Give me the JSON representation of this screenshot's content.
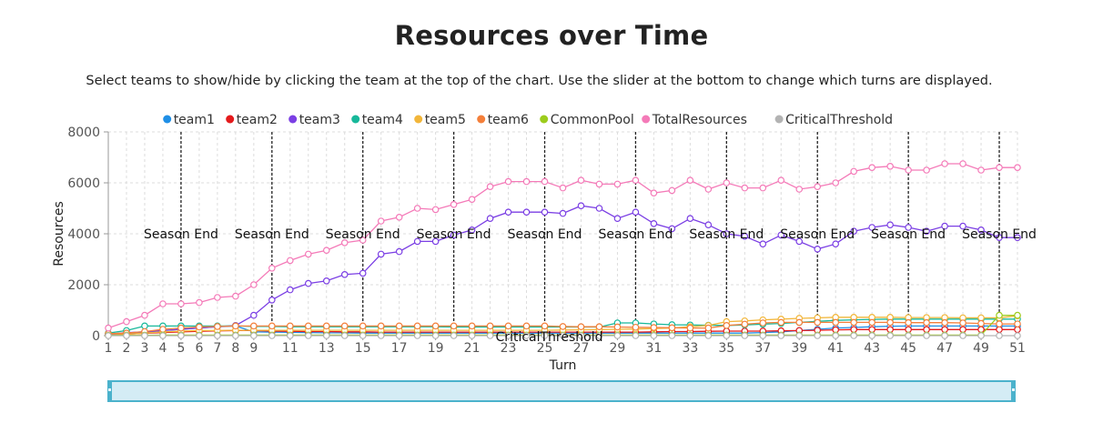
{
  "header": {
    "title": "Resources over Time",
    "subtitle": "Select teams to show/hide by clicking the team at the top of the chart. Use the slider at the bottom to change which turns are displayed."
  },
  "chart_data": {
    "type": "line",
    "xlabel": "Turn",
    "ylabel": "Resources",
    "xlim": [
      1,
      51
    ],
    "ylim": [
      0,
      8000
    ],
    "y_ticks": [
      0,
      2000,
      4000,
      6000,
      8000
    ],
    "x_ticks": [
      1,
      2,
      3,
      4,
      5,
      6,
      7,
      8,
      9,
      11,
      13,
      15,
      17,
      19,
      21,
      23,
      25,
      27,
      29,
      31,
      33,
      35,
      37,
      39,
      41,
      43,
      45,
      47,
      49,
      51
    ],
    "grid": true,
    "legend_position": "top",
    "x": [
      1,
      2,
      3,
      4,
      5,
      6,
      7,
      8,
      9,
      10,
      11,
      12,
      13,
      14,
      15,
      16,
      17,
      18,
      19,
      20,
      21,
      22,
      23,
      24,
      25,
      26,
      27,
      28,
      29,
      30,
      31,
      32,
      33,
      34,
      35,
      36,
      37,
      38,
      39,
      40,
      41,
      42,
      43,
      45,
      44,
      46,
      47,
      48,
      49,
      50,
      51
    ],
    "season_end_turns": [
      5,
      10,
      15,
      20,
      25,
      30,
      35,
      40,
      45,
      50
    ],
    "season_end_label": "Season End",
    "threshold_label": "CriticalThreshold",
    "series": [
      {
        "name": "team1",
        "color": "#1f8fe6",
        "values": [
          50,
          80,
          120,
          200,
          250,
          300,
          350,
          380,
          150,
          140,
          130,
          120,
          110,
          110,
          100,
          100,
          100,
          100,
          100,
          100,
          100,
          100,
          100,
          100,
          100,
          100,
          100,
          100,
          100,
          100,
          100,
          100,
          100,
          100,
          100,
          100,
          120,
          150,
          200,
          250,
          300,
          320,
          350,
          370,
          380,
          380,
          380,
          380,
          380,
          380,
          380
        ]
      },
      {
        "name": "team2",
        "color": "#e41a1c",
        "values": [
          30,
          60,
          90,
          120,
          150,
          170,
          190,
          200,
          200,
          180,
          170,
          160,
          160,
          150,
          150,
          140,
          140,
          140,
          140,
          140,
          140,
          140,
          140,
          140,
          140,
          140,
          140,
          140,
          140,
          140,
          150,
          160,
          160,
          170,
          180,
          180,
          180,
          190,
          200,
          210,
          230,
          240,
          240,
          240,
          240,
          240,
          240,
          240,
          240,
          240,
          240
        ]
      },
      {
        "name": "team3",
        "color": "#7b3fe4",
        "values": [
          50,
          120,
          150,
          200,
          250,
          300,
          350,
          400,
          800,
          1400,
          1800,
          2050,
          2150,
          2400,
          2450,
          3200,
          3300,
          3700,
          3700,
          3950,
          4150,
          4600,
          4850,
          4850,
          4850,
          4800,
          5100,
          5000,
          4600,
          4850,
          4400,
          4200,
          4600,
          4350,
          4000,
          3900,
          3600,
          3950,
          3700,
          3400,
          3600,
          4100,
          4250,
          4350,
          4250,
          4100,
          4300,
          4300,
          4150,
          3850,
          3850
        ]
      },
      {
        "name": "team4",
        "color": "#17b89a",
        "values": [
          100,
          200,
          380,
          380,
          380,
          380,
          380,
          380,
          360,
          360,
          350,
          350,
          350,
          350,
          350,
          350,
          350,
          350,
          350,
          340,
          340,
          340,
          340,
          340,
          340,
          340,
          340,
          340,
          500,
          500,
          460,
          430,
          420,
          410,
          400,
          420,
          450,
          480,
          520,
          560,
          600,
          620,
          640,
          650,
          650,
          650,
          650,
          650,
          650,
          650,
          650
        ]
      },
      {
        "name": "team5",
        "color": "#f2b63a",
        "values": [
          20,
          50,
          100,
          150,
          180,
          200,
          200,
          210,
          210,
          210,
          210,
          210,
          210,
          210,
          210,
          210,
          210,
          210,
          210,
          210,
          210,
          210,
          210,
          210,
          210,
          220,
          230,
          240,
          250,
          260,
          280,
          300,
          350,
          400,
          550,
          580,
          620,
          650,
          680,
          700,
          720,
          720,
          720,
          720,
          710,
          710,
          710,
          700,
          700,
          700,
          780
        ]
      },
      {
        "name": "team6",
        "color": "#f47f3a",
        "values": [
          80,
          100,
          160,
          250,
          300,
          340,
          360,
          380,
          380,
          380,
          380,
          380,
          380,
          380,
          380,
          380,
          380,
          380,
          380,
          380,
          380,
          380,
          380,
          380,
          380,
          360,
          350,
          350,
          340,
          330,
          320,
          310,
          300,
          300,
          400,
          450,
          500,
          520,
          520,
          520,
          520,
          520,
          520,
          520,
          510,
          510,
          510,
          500,
          480,
          460,
          460
        ]
      },
      {
        "name": "CommonPool",
        "color": "#9ccc1c",
        "values": [
          10,
          15,
          15,
          20,
          20,
          20,
          20,
          20,
          20,
          20,
          20,
          20,
          20,
          20,
          20,
          20,
          20,
          20,
          20,
          20,
          20,
          20,
          20,
          20,
          20,
          20,
          20,
          20,
          20,
          20,
          20,
          20,
          20,
          20,
          20,
          20,
          20,
          20,
          20,
          20,
          20,
          20,
          20,
          20,
          20,
          20,
          20,
          20,
          20,
          800,
          800
        ]
      },
      {
        "name": "TotalResources",
        "color": "#f47ab8",
        "values": [
          300,
          550,
          800,
          1250,
          1250,
          1300,
          1500,
          1550,
          2000,
          2650,
          2950,
          3200,
          3350,
          3650,
          3750,
          4500,
          4650,
          5000,
          4950,
          5150,
          5350,
          5850,
          6050,
          6050,
          6050,
          5800,
          6100,
          5950,
          5950,
          6100,
          5600,
          5700,
          6100,
          5750,
          6000,
          5800,
          5800,
          6100,
          5750,
          5850,
          6000,
          6450,
          6600,
          6650,
          6500,
          6500,
          6750,
          6750,
          6500,
          6600,
          6600
        ]
      },
      {
        "name": "CriticalThreshold",
        "color": "#b3b3b3",
        "values": [
          0,
          0,
          0,
          0,
          0,
          0,
          0,
          0,
          0,
          0,
          0,
          0,
          0,
          0,
          0,
          0,
          0,
          0,
          0,
          0,
          0,
          0,
          0,
          0,
          0,
          0,
          0,
          0,
          0,
          0,
          0,
          0,
          0,
          0,
          0,
          0,
          0,
          0,
          0,
          0,
          0,
          0,
          0,
          0,
          0,
          0,
          0,
          0,
          0,
          0,
          0
        ]
      }
    ]
  },
  "slider": {
    "range": [
      1,
      51
    ]
  }
}
